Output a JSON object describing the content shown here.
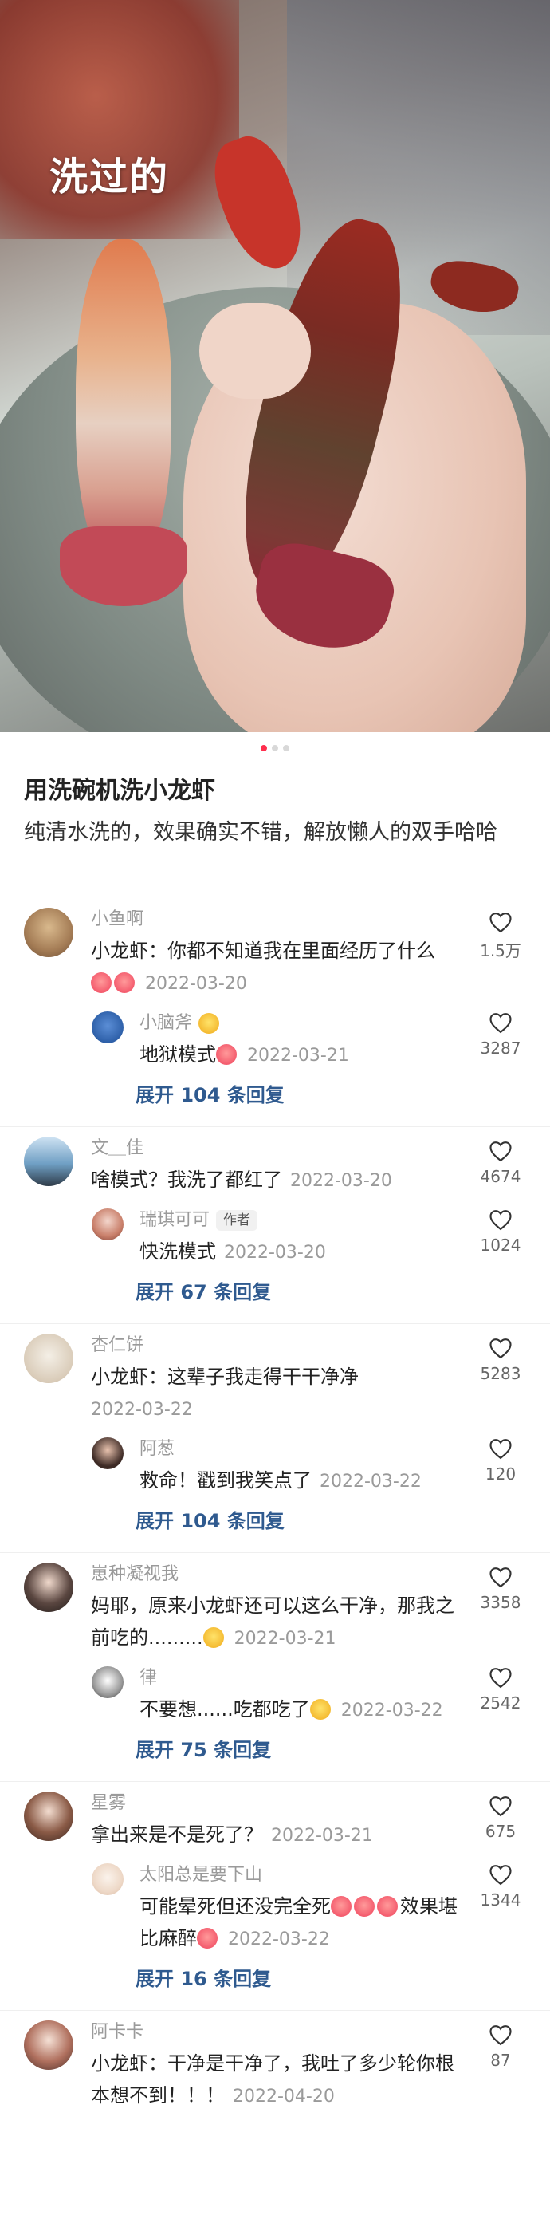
{
  "hero": {
    "label": "洗过的",
    "slides": 3,
    "active_slide": 0
  },
  "post": {
    "title": "用洗碗机洗小龙虾",
    "desc": "纯清水洗的，效果确实不错，解放懒人的双手哈哈"
  },
  "threads": [
    {
      "user": "小鱼啊",
      "text": "小龙虾：你都不知道我在里面经历了什么",
      "date": "2022-03-20",
      "likes": "1.5万",
      "reply": {
        "user": "小脑斧",
        "text": "地狱模式",
        "date": "2022-03-21",
        "likes": "3287"
      },
      "more": "展开 104 条回复"
    },
    {
      "user": "文＿佳",
      "text": "啥模式？我洗了都红了",
      "date": "2022-03-20",
      "likes": "4674",
      "reply": {
        "user": "瑞琪可可",
        "badge": "作者",
        "text": "快洗模式",
        "date": "2022-03-20",
        "likes": "1024"
      },
      "more": "展开 67 条回复"
    },
    {
      "user": "杏仁饼",
      "text": "小龙虾：这辈子我走得干干净净",
      "date": "2022-03-22",
      "likes": "5283",
      "reply": {
        "user": "阿葱",
        "text": "救命！戳到我笑点了",
        "date": "2022-03-22",
        "likes": "120"
      },
      "more": "展开 104 条回复"
    },
    {
      "user": "崽种凝视我",
      "text": "妈耶，原来小龙虾还可以这么干净，那我之前吃的.........",
      "date": "2022-03-21",
      "likes": "3358",
      "reply": {
        "user": "律",
        "text": "不要想......吃都吃了",
        "date": "2022-03-22",
        "likes": "2542"
      },
      "more": "展开 75 条回复"
    },
    {
      "user": "星雾",
      "text": "拿出来是不是死了？",
      "date": "2022-03-21",
      "likes": "675",
      "reply": {
        "user": "太阳总是要下山",
        "text": "可能晕死但还没完全死",
        "text2": "效果堪比麻醉",
        "date": "2022-03-22",
        "likes": "1344"
      },
      "more": "展开 16 条回复"
    },
    {
      "user": "阿卡卡",
      "text": "小龙虾：干净是干净了，我吐了多少轮你根本想不到！！！",
      "date": "2022-04-20",
      "likes": "87"
    }
  ]
}
